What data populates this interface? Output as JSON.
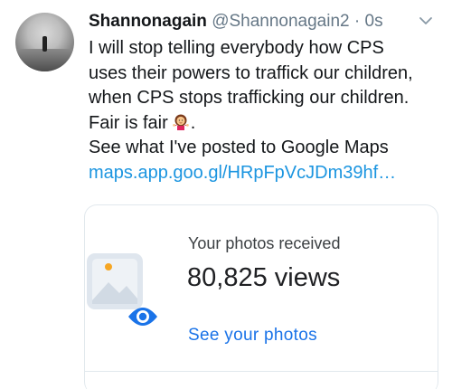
{
  "tweet": {
    "display_name": "Shannonagain",
    "handle": "@Shannonagain2",
    "separator": "·",
    "time": "0s",
    "avatar_icon": "profile-photo",
    "menu_icon": "chevron-down-icon",
    "lines": [
      "I will stop telling everybody how CPS",
      "uses their powers to traffick our children,",
      "when CPS stops trafficking our children.",
      "Fair is fair",
      "See what I've posted to Google Maps"
    ],
    "emoji": "woman-shrugging",
    "trailing_period": ".",
    "link": "maps.app.goo.gl/HRpFpVcJDm39hf…"
  },
  "card": {
    "label": "Your photos received",
    "views": "80,825 views",
    "action": "See your photos",
    "icon": "photo-views-icon",
    "colors": {
      "link": "#1a73e8",
      "eye": "#1a73e8"
    }
  },
  "colors": {
    "text": "#14171a",
    "muted": "#657786",
    "tweet_link": "#1b95e0"
  }
}
